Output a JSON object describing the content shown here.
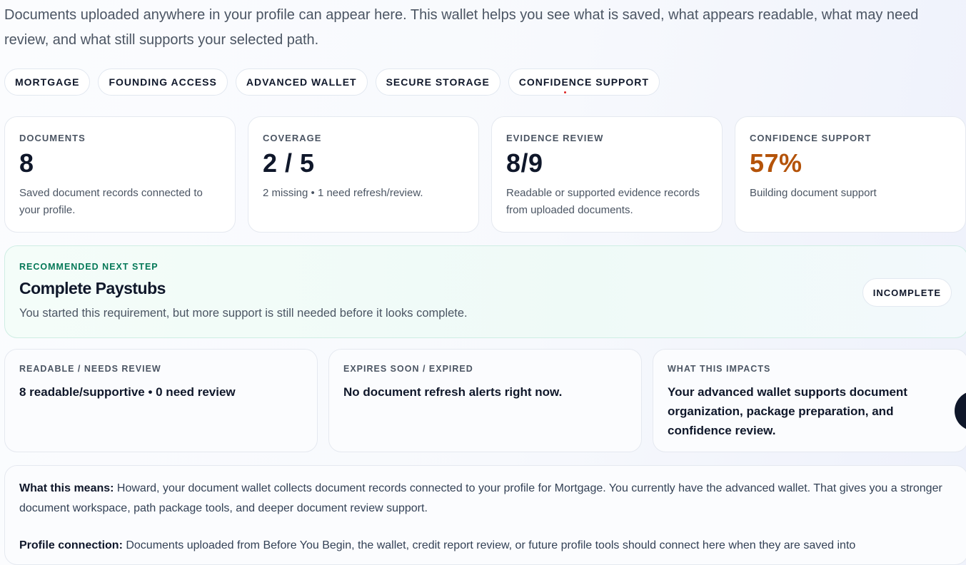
{
  "intro": "Documents uploaded anywhere in your profile can appear here. This wallet helps you see what is saved, what appears readable, what may need review, and what still supports your selected path.",
  "pills": [
    {
      "label": "MORTGAGE"
    },
    {
      "label": "FOUNDING ACCESS"
    },
    {
      "label": "ADVANCED WALLET"
    },
    {
      "label": "SECURE STORAGE"
    },
    {
      "label": "CONFIDENCE SUPPORT"
    }
  ],
  "stats": [
    {
      "label": "DOCUMENTS",
      "value": "8",
      "desc": "Saved document records connected to your profile."
    },
    {
      "label": "COVERAGE",
      "value": "2 / 5",
      "desc": "2 missing • 1 need refresh/review."
    },
    {
      "label": "EVIDENCE REVIEW",
      "value": "8/9",
      "desc": "Readable or supported evidence records from uploaded documents."
    },
    {
      "label": "CONFIDENCE SUPPORT",
      "value": "57%",
      "desc": "Building document support",
      "value_color": "#b45309"
    }
  ],
  "next_step": {
    "label": "RECOMMENDED NEXT STEP",
    "title": "Complete Paystubs",
    "desc": "You started this requirement, but more support is still needed before it looks complete.",
    "status": "INCOMPLETE"
  },
  "info_cards": [
    {
      "label": "READABLE / NEEDS REVIEW",
      "text": "8 readable/supportive • 0 need review"
    },
    {
      "label": "EXPIRES SOON / EXPIRED",
      "text": "No document refresh alerts right now."
    },
    {
      "label": "WHAT THIS IMPACTS",
      "text": "Your advanced wallet supports document organization, package preparation, and confidence review."
    }
  ],
  "means": {
    "heading": "What this means:",
    "text": " Howard, your document wallet collects document records connected to your profile for Mortgage. You currently have the advanced wallet. That gives you a stronger document workspace, path package tools, and deeper document review support.",
    "heading2": "Profile connection:",
    "text2": " Documents uploaded from Before You Begin, the wallet, credit report review, or future profile tools should connect here when they are saved into"
  },
  "colors": {
    "accent_green": "#047857",
    "accent_orange": "#b45309",
    "text_dark": "#0f172a"
  }
}
